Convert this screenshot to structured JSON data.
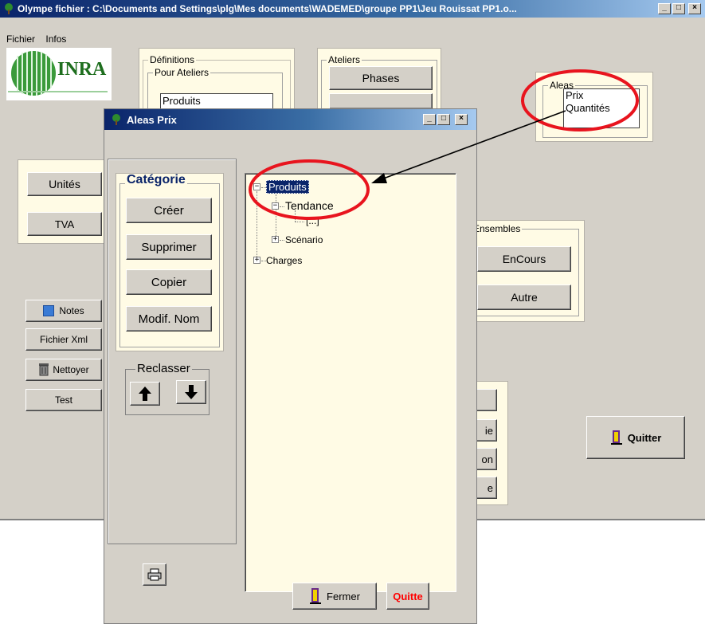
{
  "main_window": {
    "title": "Olympe  fichier : C:\\Documents and Settings\\plg\\Mes documents\\WADEMED\\groupe PP1\\Jeu Rouissat PP1.o...",
    "menu": [
      "Fichier",
      "Infos"
    ],
    "logo_text": "INRA",
    "definitions": {
      "legend": "Définitions",
      "sub_legend": "Pour Ateliers",
      "item": "Produits"
    },
    "ateliers": {
      "legend": "Ateliers",
      "phases": "Phases"
    },
    "aleas": {
      "legend": "Aleas",
      "items": [
        "Prix",
        "Quantités"
      ]
    },
    "left_buttons": {
      "unites": "Unités",
      "tva": "TVA",
      "notes": "Notes",
      "fichier_xml": "Fichier Xml",
      "nettoyer": "Nettoyer",
      "test": "Test"
    },
    "ensembles": {
      "legend": "Ensembles",
      "encours": "EnCours",
      "autre": "Autre"
    },
    "partial_buttons": [
      "",
      "ie",
      "on",
      "e"
    ],
    "quitter": "Quitter"
  },
  "dialog": {
    "title": "Aleas Prix",
    "categorie": {
      "legend": "Catégorie",
      "creer": "Créer",
      "supprimer": "Supprimer",
      "copier": "Copier",
      "modif_nom": "Modif. Nom"
    },
    "reclasser": {
      "legend": "Reclasser"
    },
    "tree": {
      "produits": "Produits",
      "tendance": "Tendance",
      "placeholder": "[...]",
      "scenario": "Scénario",
      "charges": "Charges"
    },
    "fermer": "Fermer",
    "quitte": "Quitte"
  },
  "colors": {
    "panel": "#fffbe5",
    "window": "#d4d0c8",
    "highlight_ring": "#e8141e",
    "selection": "#0a246a",
    "quitte_text": "#ff0000"
  }
}
